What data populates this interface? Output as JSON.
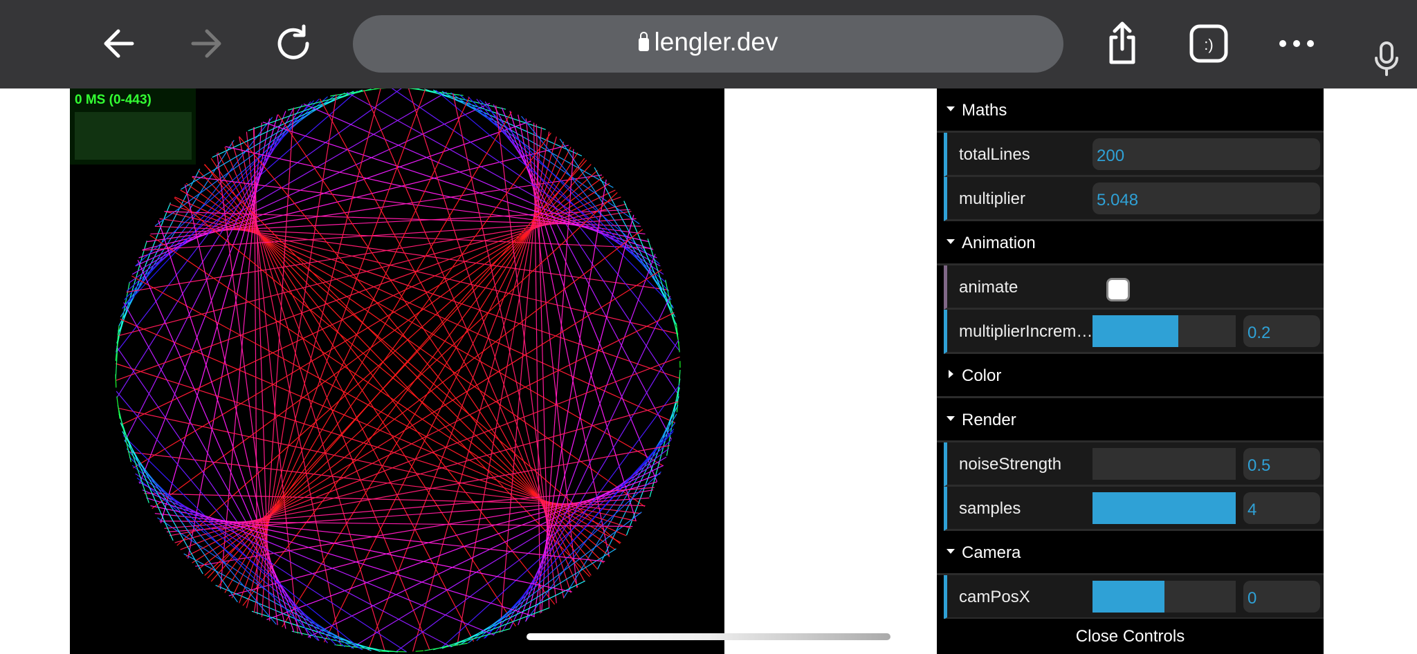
{
  "browser": {
    "url": "lengler.dev"
  },
  "stats": {
    "label": "0 MS (0-443)"
  },
  "art": {
    "totalLines": 200,
    "multiplier": 5.048
  },
  "panel": {
    "maths": {
      "title": "Maths",
      "totalLines_label": "totalLines",
      "totalLines": "200",
      "multiplier_label": "multiplier",
      "multiplier": "5.048"
    },
    "animation": {
      "title": "Animation",
      "animate_label": "animate",
      "animate": false,
      "inc_label": "multiplierIncrem…",
      "inc": "0.2",
      "inc_fraction": 0.6
    },
    "color": {
      "title": "Color"
    },
    "render": {
      "title": "Render",
      "noise_label": "noiseStrength",
      "noise": "0.5",
      "noise_fraction": 0,
      "samples_label": "samples",
      "samples": "4",
      "samples_fraction": 1
    },
    "camera": {
      "title": "Camera",
      "campos_label": "camPosX",
      "campos": "0",
      "campos_fraction": 0.5
    },
    "close": "Close Controls"
  }
}
